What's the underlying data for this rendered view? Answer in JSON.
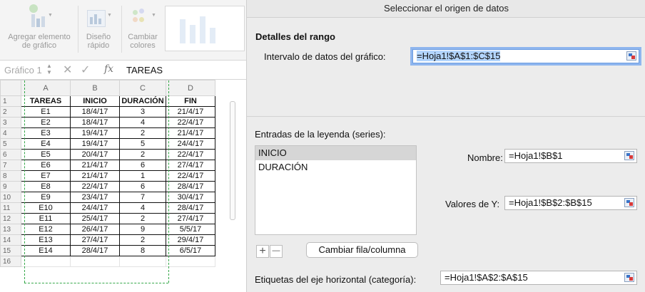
{
  "ribbon": {
    "add_element": "Agregar elemento de gráfico",
    "quick_layout": "Diseño rápido",
    "change_colors": "Cambiar colores"
  },
  "formula_bar": {
    "name_box": "Gráfico 1",
    "cancel_icon": "✕",
    "enter_icon": "✓",
    "fx_label": "fx",
    "value": "TAREAS"
  },
  "sheet": {
    "columns": [
      "A",
      "B",
      "C",
      "D"
    ],
    "rows": [
      {
        "n": "1",
        "a": "TAREAS",
        "b": "INICIO",
        "c": "DURACIÓN",
        "d": "FIN"
      },
      {
        "n": "2",
        "a": "E1",
        "b": "18/4/17",
        "c": "3",
        "d": "21/4/17"
      },
      {
        "n": "3",
        "a": "E2",
        "b": "18/4/17",
        "c": "4",
        "d": "22/4/17"
      },
      {
        "n": "4",
        "a": "E3",
        "b": "19/4/17",
        "c": "2",
        "d": "21/4/17"
      },
      {
        "n": "5",
        "a": "E4",
        "b": "19/4/17",
        "c": "5",
        "d": "24/4/17"
      },
      {
        "n": "6",
        "a": "E5",
        "b": "20/4/17",
        "c": "2",
        "d": "22/4/17"
      },
      {
        "n": "7",
        "a": "E6",
        "b": "21/4/17",
        "c": "6",
        "d": "27/4/17"
      },
      {
        "n": "8",
        "a": "E7",
        "b": "21/4/17",
        "c": "1",
        "d": "22/4/17"
      },
      {
        "n": "9",
        "a": "E8",
        "b": "22/4/17",
        "c": "6",
        "d": "28/4/17"
      },
      {
        "n": "10",
        "a": "E9",
        "b": "23/4/17",
        "c": "7",
        "d": "30/4/17"
      },
      {
        "n": "11",
        "a": "E10",
        "b": "24/4/17",
        "c": "4",
        "d": "28/4/17"
      },
      {
        "n": "12",
        "a": "E11",
        "b": "25/4/17",
        "c": "2",
        "d": "27/4/17"
      },
      {
        "n": "13",
        "a": "E12",
        "b": "26/4/17",
        "c": "9",
        "d": "5/5/17"
      },
      {
        "n": "14",
        "a": "E13",
        "b": "27/4/17",
        "c": "2",
        "d": "29/4/17"
      },
      {
        "n": "15",
        "a": "E14",
        "b": "28/4/17",
        "c": "8",
        "d": "6/5/17"
      },
      {
        "n": "16",
        "a": "",
        "b": "",
        "c": "",
        "d": ""
      }
    ]
  },
  "dialog": {
    "title": "Seleccionar el origen de datos",
    "range_heading": "Detalles del rango",
    "range_label": "Intervalo de datos del gráfico:",
    "range_value": "=Hoja1!$A$1:$C$15",
    "legend_heading": "Entradas de la leyenda (series):",
    "series": [
      "INICIO",
      "DURACIÓN"
    ],
    "name_label": "Nombre:",
    "name_value": "=Hoja1!$B$1",
    "y_label": "Valores de Y:",
    "y_value": "=Hoja1!$B$2:$B$15",
    "add_symbol": "+",
    "remove_symbol": "—",
    "switch_button": "Cambiar fila/columna",
    "axis_label": "Etiquetas del eje horizontal (categoría):",
    "axis_value": "=Hoja1!$A$2:$A$15"
  }
}
